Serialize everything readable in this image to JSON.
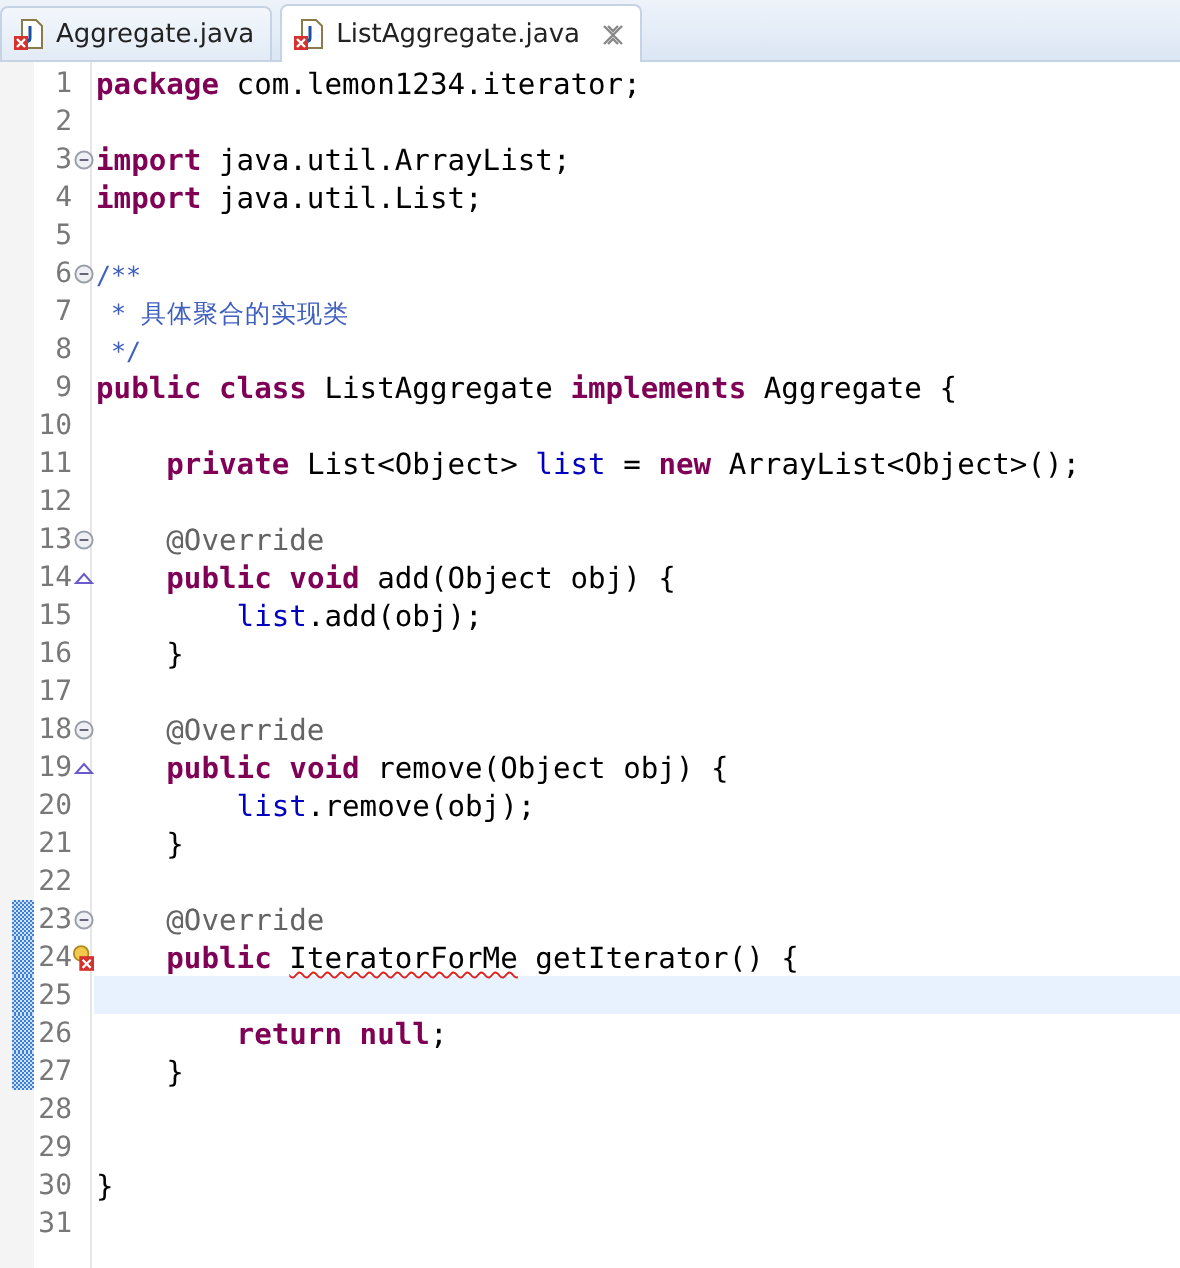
{
  "tabs": [
    {
      "label": "Aggregate.java",
      "selected": false,
      "closable": false
    },
    {
      "label": "ListAggregate.java",
      "selected": true,
      "closable": true
    }
  ],
  "lines": [
    {
      "number": "1",
      "ruler_mark": false,
      "current": false,
      "tokens": [
        {
          "kind": "keyword",
          "text": "package"
        },
        {
          "kind": "plain",
          "text": " com.lemon1234.iterator;"
        }
      ]
    },
    {
      "number": "2",
      "ruler_mark": false,
      "current": false
    },
    {
      "number": "3",
      "gutter_icon": {
        "kind": "fold"
      },
      "ruler_mark": false,
      "current": false,
      "tokens": [
        {
          "kind": "keyword",
          "text": "import"
        },
        {
          "kind": "plain",
          "text": " java.util.ArrayList;"
        }
      ]
    },
    {
      "number": "4",
      "ruler_mark": false,
      "current": false,
      "tokens": [
        {
          "kind": "keyword",
          "text": "import"
        },
        {
          "kind": "plain",
          "text": " java.util.List;"
        }
      ]
    },
    {
      "number": "5",
      "ruler_mark": false,
      "current": false
    },
    {
      "number": "6",
      "gutter_icon": {
        "kind": "fold"
      },
      "ruler_mark": false,
      "current": false,
      "tokens": [
        {
          "kind": "doc",
          "text": "/**"
        }
      ]
    },
    {
      "number": "7",
      "ruler_mark": false,
      "current": false,
      "tokens": [
        {
          "kind": "doc",
          "text": " * 具体聚合的实现类"
        }
      ]
    },
    {
      "number": "8",
      "ruler_mark": false,
      "current": false,
      "tokens": [
        {
          "kind": "doc",
          "text": " */"
        }
      ]
    },
    {
      "number": "9",
      "ruler_mark": false,
      "current": false,
      "tokens": [
        {
          "kind": "keyword",
          "text": "public"
        },
        {
          "kind": "keyword",
          "text": " class"
        },
        {
          "kind": "plain",
          "text": " ListAggregate"
        },
        {
          "kind": "keyword",
          "text": " implements"
        },
        {
          "kind": "plain",
          "text": " Aggregate {"
        }
      ]
    },
    {
      "number": "10",
      "ruler_mark": false,
      "current": false
    },
    {
      "number": "11",
      "ruler_mark": false,
      "current": false,
      "tokens": [
        {
          "kind": "keyword",
          "text": "    private"
        },
        {
          "kind": "plain",
          "text": " List<Object>"
        },
        {
          "kind": "field",
          "text": " list"
        },
        {
          "kind": "plain",
          "text": " ="
        },
        {
          "kind": "keyword",
          "text": " new"
        },
        {
          "kind": "plain",
          "text": " ArrayList<Object>();"
        }
      ]
    },
    {
      "number": "12",
      "ruler_mark": false,
      "current": false
    },
    {
      "number": "13",
      "gutter_icon": {
        "kind": "fold"
      },
      "ruler_mark": false,
      "current": false,
      "tokens": [
        {
          "kind": "annotation",
          "text": "    @Override"
        }
      ]
    },
    {
      "number": "14",
      "gutter_icon": {
        "kind": "override"
      },
      "ruler_mark": false,
      "current": false,
      "tokens": [
        {
          "kind": "keyword",
          "text": "    public"
        },
        {
          "kind": "keyword",
          "text": " void"
        },
        {
          "kind": "plain",
          "text": " add(Object obj) {"
        }
      ]
    },
    {
      "number": "15",
      "ruler_mark": false,
      "current": false,
      "tokens": [
        {
          "kind": "field",
          "text": "        list"
        },
        {
          "kind": "plain",
          "text": ".add(obj);"
        }
      ]
    },
    {
      "number": "16",
      "ruler_mark": false,
      "current": false,
      "tokens": [
        {
          "kind": "plain",
          "text": "    }"
        }
      ]
    },
    {
      "number": "17",
      "ruler_mark": false,
      "current": false
    },
    {
      "number": "18",
      "gutter_icon": {
        "kind": "fold"
      },
      "ruler_mark": false,
      "current": false,
      "tokens": [
        {
          "kind": "annotation",
          "text": "    @Override"
        }
      ]
    },
    {
      "number": "19",
      "gutter_icon": {
        "kind": "override"
      },
      "ruler_mark": false,
      "current": false,
      "tokens": [
        {
          "kind": "keyword",
          "text": "    public"
        },
        {
          "kind": "keyword",
          "text": " void"
        },
        {
          "kind": "plain",
          "text": " remove(Object obj) {"
        }
      ]
    },
    {
      "number": "20",
      "ruler_mark": false,
      "current": false,
      "tokens": [
        {
          "kind": "field",
          "text": "        list"
        },
        {
          "kind": "plain",
          "text": ".remove(obj);"
        }
      ]
    },
    {
      "number": "21",
      "ruler_mark": false,
      "current": false,
      "tokens": [
        {
          "kind": "plain",
          "text": "    }"
        }
      ]
    },
    {
      "number": "22",
      "ruler_mark": false,
      "current": false
    },
    {
      "number": "23",
      "gutter_icon": {
        "kind": "fold"
      },
      "ruler_mark": true,
      "current": false,
      "tokens": [
        {
          "kind": "annotation",
          "text": "    @Override"
        }
      ]
    },
    {
      "number": "24",
      "gutter_icon": {
        "kind": "error"
      },
      "ruler_mark": true,
      "current": false,
      "tokens": [
        {
          "kind": "keyword",
          "text": "    public "
        },
        {
          "kind": "error",
          "text": "IteratorForMe"
        },
        {
          "kind": "plain",
          "text": " getIterator() {"
        }
      ]
    },
    {
      "number": "25",
      "ruler_mark": true,
      "current": true
    },
    {
      "number": "26",
      "ruler_mark": true,
      "current": false,
      "tokens": [
        {
          "kind": "keyword",
          "text": "        return"
        },
        {
          "kind": "keyword",
          "text": " null"
        },
        {
          "kind": "plain",
          "text": ";"
        }
      ]
    },
    {
      "number": "27",
      "ruler_mark": true,
      "current": false,
      "tokens": [
        {
          "kind": "plain",
          "text": "    }"
        }
      ]
    },
    {
      "number": "28",
      "ruler_mark": false,
      "current": false
    },
    {
      "number": "29",
      "ruler_mark": false,
      "current": false
    },
    {
      "number": "30",
      "ruler_mark": false,
      "current": false,
      "tokens": [
        {
          "kind": "plain",
          "text": "}"
        }
      ]
    },
    {
      "number": "31",
      "ruler_mark": false,
      "current": false
    }
  ]
}
